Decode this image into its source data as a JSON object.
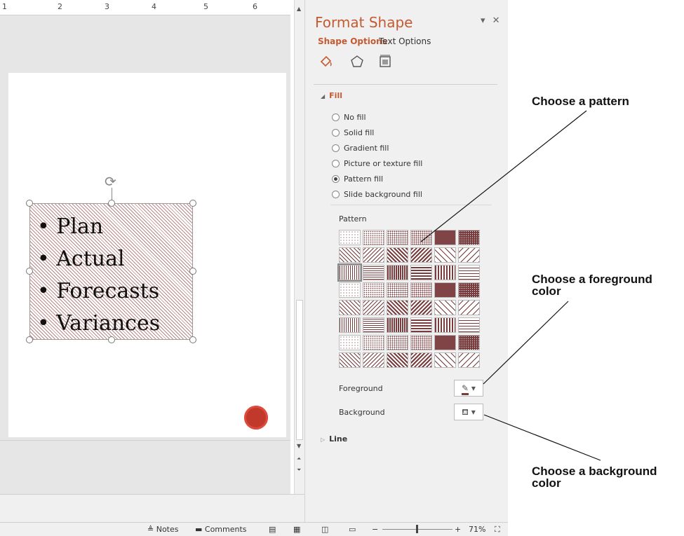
{
  "ruler": {
    "marks": [
      "1",
      "2",
      "3",
      "4",
      "5",
      "6"
    ]
  },
  "slide": {
    "bullets": [
      "Plan",
      "Actual",
      "Forecasts",
      "Variances"
    ]
  },
  "pane": {
    "title": "Format Shape",
    "tabs": [
      "Shape Options",
      "Text Options"
    ],
    "icons": [
      "fill-line-icon",
      "effects-icon",
      "size-properties-icon"
    ],
    "fill_header": "Fill",
    "fill_options": [
      {
        "label": "No fill",
        "selected": false
      },
      {
        "label": "Solid fill",
        "selected": false
      },
      {
        "label": "Gradient fill",
        "selected": false
      },
      {
        "label": "Picture or texture fill",
        "selected": false
      },
      {
        "label": "Pattern fill",
        "selected": true
      },
      {
        "label": "Slide background fill",
        "selected": false
      }
    ],
    "pattern_label": "Pattern",
    "pattern_color": "#7a3b3d",
    "selected_pattern_row": 3,
    "selected_pattern_col": 1,
    "foreground_label": "Foreground",
    "background_label": "Background",
    "line_header": "Line"
  },
  "status": {
    "notes": "Notes",
    "comments": "Comments",
    "zoom": "71%"
  },
  "annotations": {
    "pattern": "Choose a pattern",
    "foreground_1": "Choose a foreground",
    "foreground_2": "color",
    "background_1": "Choose a background",
    "background_2": "color"
  }
}
